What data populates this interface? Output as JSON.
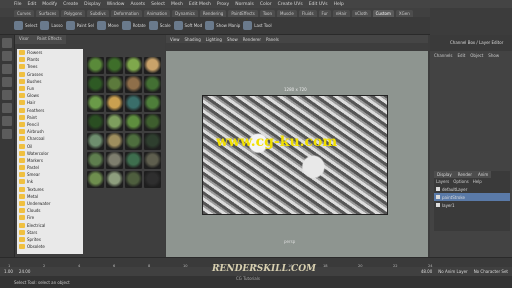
{
  "app": {
    "menus": [
      "File",
      "Edit",
      "Modify",
      "Create",
      "Display",
      "Window",
      "Assets",
      "Select",
      "Mesh",
      "Edit Mesh",
      "Proxy",
      "Normals",
      "Color",
      "Create UVs",
      "Edit UVs",
      "Help"
    ]
  },
  "shelf": {
    "tabs": [
      "Curves",
      "Surfaces",
      "Polygons",
      "Subdivs",
      "Deformation",
      "Animation",
      "Dynamics",
      "Rendering",
      "PaintEffects",
      "Toon",
      "Muscle",
      "Fluids",
      "Fur",
      "nHair",
      "nCloth",
      "Custom",
      "XGen"
    ],
    "active_tab": "Custom",
    "tools": [
      {
        "label": "Select"
      },
      {
        "label": "Lasso"
      },
      {
        "label": "Paint Sel"
      },
      {
        "label": "Move"
      },
      {
        "label": "Rotate"
      },
      {
        "label": "Scale"
      },
      {
        "label": "Soft Mod"
      },
      {
        "label": "Show Manip"
      },
      {
        "label": "Last Tool"
      }
    ]
  },
  "browser": {
    "tabs": [
      "Visor",
      "Paint Effects"
    ],
    "folders": [
      "Flowers",
      "Plants",
      "Trees",
      "Grasses",
      "Bushes",
      "Fun",
      "Glows",
      "Hair",
      "Feathers",
      "Paint",
      "Pencil",
      "Airbrush",
      "Charcoal",
      "Oil",
      "Watercolor",
      "Markers",
      "Pastel",
      "Smear",
      "Ink",
      "Textures",
      "Metal",
      "Underwater",
      "Clouds",
      "Fire",
      "Electrical",
      "Stars",
      "Sprites",
      "Obsolete"
    ],
    "thumbs": [
      "#5a8a3a",
      "#3e6e2a",
      "#7fa84c",
      "#c9a36a",
      "#2e5a24",
      "#5c7a3c",
      "#8f6f4a",
      "#436f33",
      "#6a9a48",
      "#caa050",
      "#3a6e6a",
      "#4e7e3a",
      "#2a4e22",
      "#7e9e5e",
      "#5e8e3e",
      "#3e5e2e",
      "#6e8e6e",
      "#9e8e5e",
      "#4e6e3e",
      "#2e3e2e",
      "#5e7e4e",
      "#7e7e6e",
      "#3e6e4e",
      "#5e5e4e",
      "#6e8e4e",
      "#8e9e7e",
      "#4e5e3e",
      "#2e2e2e"
    ]
  },
  "viewport": {
    "menus": [
      "View",
      "Shading",
      "Lighting",
      "Show",
      "Renderer",
      "Panels"
    ],
    "resolution": "1280 x 720",
    "camera": "persp",
    "watermark": "www.cg-ku.com"
  },
  "right_panel": {
    "title": "Channel Box / Layer Editor",
    "tabs": [
      "Channels",
      "Edit",
      "Object",
      "Show"
    ],
    "layer_tabs": [
      "Display",
      "Render",
      "Anim"
    ],
    "layer_menus": [
      "Layers",
      "Options",
      "Help"
    ],
    "layers": [
      {
        "name": "defaultLayer",
        "selected": false
      },
      {
        "name": "paintStroke",
        "selected": true
      },
      {
        "name": "layer1",
        "selected": false
      }
    ]
  },
  "timeline": {
    "ticks": [
      "1",
      "2",
      "4",
      "6",
      "8",
      "10",
      "12",
      "14",
      "16",
      "18",
      "20",
      "22",
      "24"
    ],
    "start": "1.00",
    "end": "24.00",
    "range_end": "48.00",
    "anim_layer": "No Anim Layer",
    "char_set": "No Character Set"
  },
  "status": {
    "text": "Select Tool: select an object"
  },
  "logo": {
    "text": "RENDERSKILL.COM",
    "sub": "CG Tutorials"
  }
}
